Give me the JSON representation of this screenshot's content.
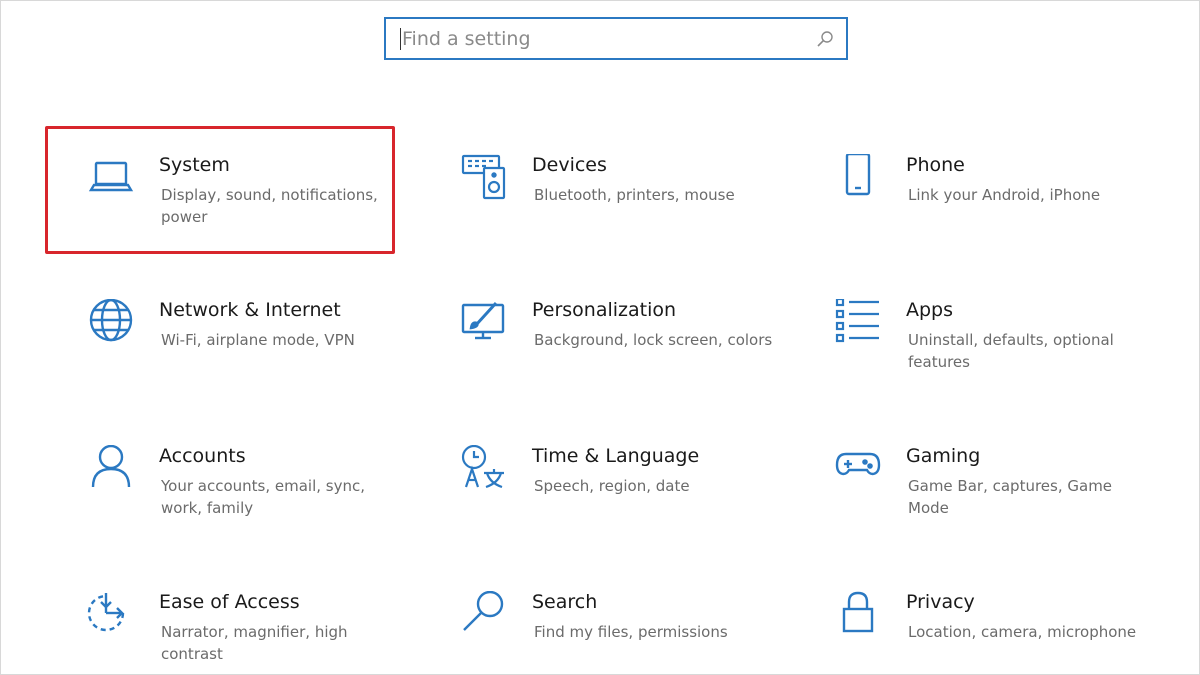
{
  "search": {
    "placeholder": "Find a setting",
    "icon": "search-icon"
  },
  "accent_color": "#2b79c2",
  "highlight_color": "#d8262c",
  "highlighted_tile": "system",
  "tiles": [
    {
      "id": "system",
      "icon": "laptop-icon",
      "title": "System",
      "desc": "Display, sound, notifications, power"
    },
    {
      "id": "devices",
      "icon": "devices-icon",
      "title": "Devices",
      "desc": "Bluetooth, printers, mouse"
    },
    {
      "id": "phone",
      "icon": "phone-icon",
      "title": "Phone",
      "desc": "Link your Android, iPhone"
    },
    {
      "id": "network",
      "icon": "globe-icon",
      "title": "Network & Internet",
      "desc": "Wi-Fi, airplane mode, VPN"
    },
    {
      "id": "personalization",
      "icon": "paintbrush-monitor-icon",
      "title": "Personalization",
      "desc": "Background, lock screen, colors"
    },
    {
      "id": "apps",
      "icon": "apps-list-icon",
      "title": "Apps",
      "desc": "Uninstall, defaults, optional features"
    },
    {
      "id": "accounts",
      "icon": "person-icon",
      "title": "Accounts",
      "desc": "Your accounts, email, sync, work, family"
    },
    {
      "id": "time-language",
      "icon": "time-language-icon",
      "title": "Time & Language",
      "desc": "Speech, region, date"
    },
    {
      "id": "gaming",
      "icon": "gamepad-icon",
      "title": "Gaming",
      "desc": "Game Bar, captures, Game Mode"
    },
    {
      "id": "ease-of-access",
      "icon": "ease-of-access-icon",
      "title": "Ease of Access",
      "desc": "Narrator, magnifier, high contrast"
    },
    {
      "id": "search",
      "icon": "magnifier-icon",
      "title": "Search",
      "desc": "Find my files, permissions"
    },
    {
      "id": "privacy",
      "icon": "lock-icon",
      "title": "Privacy",
      "desc": "Location, camera, microphone"
    }
  ]
}
